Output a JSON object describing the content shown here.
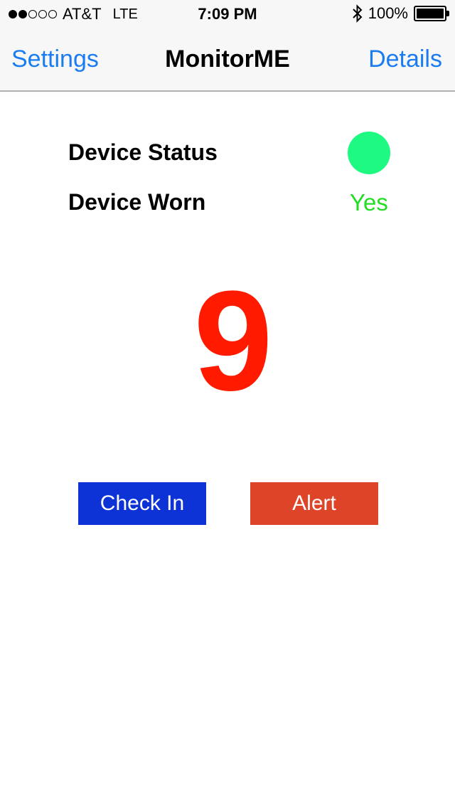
{
  "status_bar": {
    "signal_dots": [
      true,
      true,
      false,
      false,
      false
    ],
    "carrier": "AT&T",
    "network": "LTE",
    "time": "7:09 PM",
    "bluetooth_icon": "bluetooth-icon",
    "battery_percent": "100%",
    "battery_level": 1.0
  },
  "nav": {
    "left_label": "Settings",
    "title": "MonitorME",
    "right_label": "Details"
  },
  "device": {
    "status_label": "Device Status",
    "status_indicator_color": "#1ef982",
    "worn_label": "Device Worn",
    "worn_value": "Yes",
    "worn_value_color": "#22dd22"
  },
  "counter": {
    "value": "9",
    "color": "#ff1a00"
  },
  "buttons": {
    "check_in_label": "Check In",
    "check_in_color": "#0d33d6",
    "alert_label": "Alert",
    "alert_color": "#de4427"
  },
  "colors": {
    "accent": "#1a7cf0"
  }
}
